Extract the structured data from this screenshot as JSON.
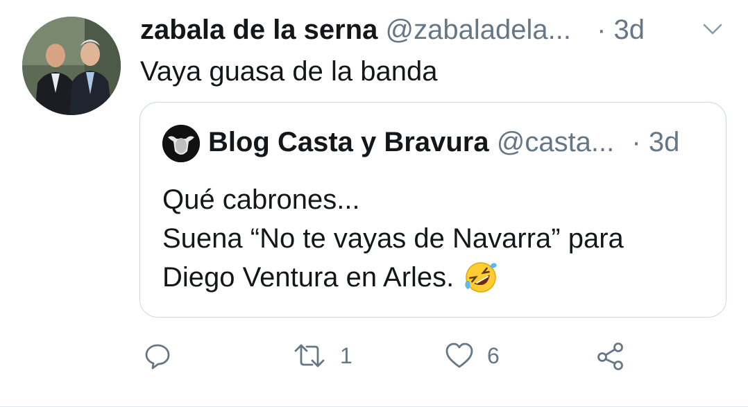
{
  "tweet": {
    "author_name": "zabala de la serna",
    "author_handle": "@zabaladela...",
    "time": "· 3d",
    "text": "Vaya guasa de la banda",
    "avatar_icon": "profile-photo-two-men",
    "menu_icon": "chevron-down-icon"
  },
  "quoted_tweet": {
    "author_name": "Blog Casta y Bravura",
    "author_handle": "@casta...",
    "time": "· 3d",
    "lines": [
      "Qué cabrones...",
      "Suena “No te vayas de Navarra” para",
      "Diego Ventura en Arles."
    ],
    "emoji": "rolling-on-floor-laughing-emoji",
    "avatar_icon": "bull-head-avatar"
  },
  "actions": {
    "reply": {
      "icon": "reply-icon"
    },
    "retweet": {
      "icon": "retweet-icon",
      "count": "1"
    },
    "like": {
      "icon": "heart-icon",
      "count": "6"
    },
    "share": {
      "icon": "share-icon"
    }
  },
  "colors": {
    "text": "#14171a",
    "secondary": "#657786",
    "border": "#ccd6dd"
  }
}
